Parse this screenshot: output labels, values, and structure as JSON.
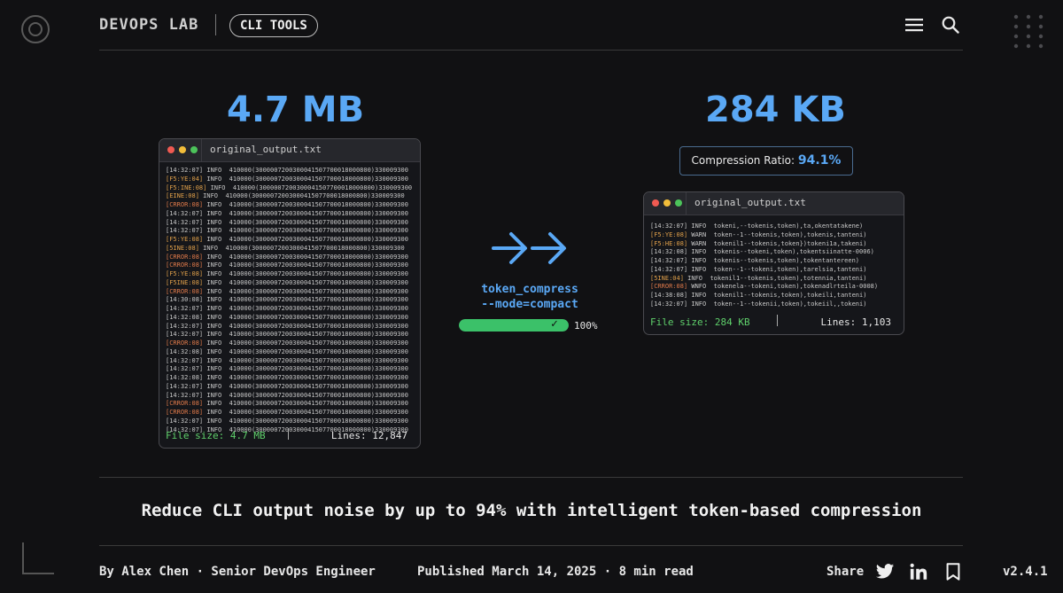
{
  "header": {
    "brand": "DEVOPS LAB",
    "category": "CLI TOOLS",
    "icons": [
      "menu-icon",
      "search-icon",
      "dots-grid-icon"
    ]
  },
  "original": {
    "size_big": "4.7 MB",
    "window_title": "original_output.txt",
    "file_size": "File size: 4.7 MB",
    "lines": "Lines: 12,847",
    "log_rows": [
      {
        "ts": "[14:32:07]",
        "kind": "time"
      },
      {
        "ts": "[F5:YE:04]",
        "kind": "warn"
      },
      {
        "ts": "[F5:INE:08]",
        "kind": "warn"
      },
      {
        "ts": "[EINE:08]",
        "kind": "warn"
      },
      {
        "ts": "[CRROR:08]",
        "kind": "err"
      },
      {
        "ts": "[14:32:07]",
        "kind": "time"
      },
      {
        "ts": "[14:32:07]",
        "kind": "time"
      },
      {
        "ts": "[14:32:07]",
        "kind": "time"
      },
      {
        "ts": "[F5:YE:08]",
        "kind": "warn"
      },
      {
        "ts": "[5INE:08]",
        "kind": "warn"
      },
      {
        "ts": "[CRROR:08]",
        "kind": "err"
      },
      {
        "ts": "[CRROR:08]",
        "kind": "err"
      },
      {
        "ts": "[F5:YE:08]",
        "kind": "warn"
      },
      {
        "ts": "[F5INE:08]",
        "kind": "warn"
      },
      {
        "ts": "[CRROR:08]",
        "kind": "err"
      },
      {
        "ts": "[14:30:08]",
        "kind": "time"
      },
      {
        "ts": "[14:32:07]",
        "kind": "time"
      },
      {
        "ts": "[14:32:08]",
        "kind": "time"
      },
      {
        "ts": "[14:32:07]",
        "kind": "time"
      },
      {
        "ts": "[14:32:07]",
        "kind": "time"
      },
      {
        "ts": "[CRROR:08]",
        "kind": "err"
      },
      {
        "ts": "[14:32:08]",
        "kind": "time"
      },
      {
        "ts": "[14:32:07]",
        "kind": "time"
      },
      {
        "ts": "[14:32:07]",
        "kind": "time"
      },
      {
        "ts": "[14:32:08]",
        "kind": "time"
      },
      {
        "ts": "[14:32:07]",
        "kind": "time"
      },
      {
        "ts": "[14:32:07]",
        "kind": "time"
      },
      {
        "ts": "[CRROR:08]",
        "kind": "err"
      },
      {
        "ts": "[CRROR:08]",
        "kind": "err"
      },
      {
        "ts": "[14:32:07]",
        "kind": "time"
      },
      {
        "ts": "[14:32:07]",
        "kind": "time"
      }
    ],
    "log_body": "INFO  410000(3000007200300041507700018000800)330009300"
  },
  "flow": {
    "arrows_icon": "double-arrow-icon",
    "command_line1": "token_compress",
    "command_line2": "--mode=compact",
    "progress": 1.0,
    "progress_label": "100%"
  },
  "compressed": {
    "size_big": "284 KB",
    "ratio_label": "Compression Ratio:",
    "ratio_value": "94.1%",
    "window_title": "original_output.txt",
    "file_size": "File size: 284 KB",
    "lines": "Lines: 1,103",
    "log_rows": [
      {
        "ts": "[14:32:07]",
        "kind": "time",
        "text": "INFO  tokeni,--tokenis,token),ta,okentatakene)"
      },
      {
        "ts": "[F5:YE:08]",
        "kind": "warn",
        "text": "WARN  token--1--tokenis,token),tokenis,tanteni)"
      },
      {
        "ts": "[F5:HE:08]",
        "kind": "warn",
        "text": "WARN  tokenil1--tokenis,token})tokeni1a,takeni)"
      },
      {
        "ts": "[14:32:08]",
        "kind": "time",
        "text": "INFO  tokenis--tokeni,token),tokentsiinatte-0006)"
      },
      {
        "ts": "[14:32:07]",
        "kind": "time",
        "text": "INFO  tokenis--tokenis,token),tokentantereen)"
      },
      {
        "ts": "[14:32:07]",
        "kind": "time",
        "text": "INFO  token--1--tokeni,token),tarelsia,tanteni)"
      },
      {
        "ts": "[5INE:04]",
        "kind": "warn",
        "text": "INFO  tokenil1--tokenis,token),totennia,tanteni)"
      },
      {
        "ts": "[CRROR:08]",
        "kind": "err",
        "text": "WNFO  tokenela--tokeni,token),tokenadlrteila-0008)"
      },
      {
        "ts": "[14:38:08]",
        "kind": "time",
        "text": "INFO  tokenil1--tokenis,token),tokeili,tanteni)"
      },
      {
        "ts": "[14:32:07]",
        "kind": "time",
        "text": "INFO  token--1--tokenii,token),tokeiil,,tokeni)"
      }
    ]
  },
  "tagline": "Reduce CLI output noise by up to 94% with intelligent token-based compression",
  "footer": {
    "byline": "By Alex Chen · Senior DevOps Engineer",
    "published": "Published March 14, 2025 · 8 min read",
    "share_label": "Share",
    "share_icons": [
      "twitter-icon",
      "linkedin-icon",
      "bookmark-icon"
    ],
    "version": "v2.4.1"
  },
  "colors": {
    "accent_blue": "#5aa8f5",
    "green": "#5fd06b",
    "warn": "#e0a04a",
    "error": "#e07a4a"
  }
}
